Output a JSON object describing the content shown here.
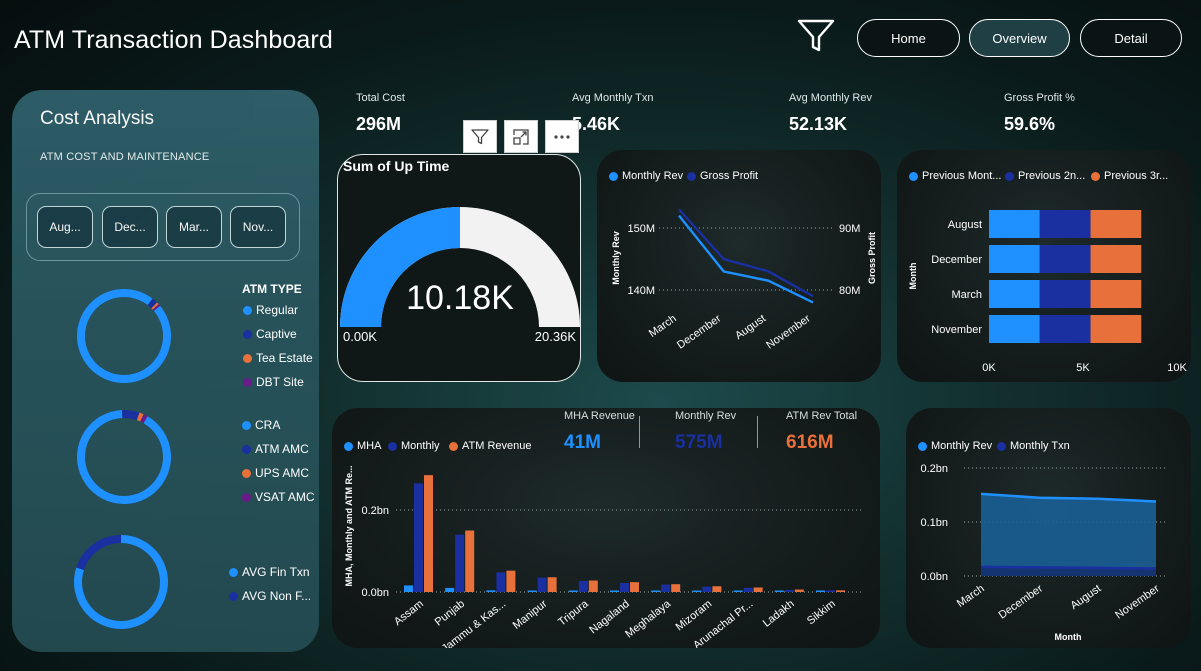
{
  "header": {
    "title": "ATM Transaction Dashboard",
    "nav": [
      "Home",
      "Overview",
      "Detail"
    ],
    "active_nav": "Overview"
  },
  "cost_panel": {
    "title": "Cost Analysis",
    "subtitle": "ATM COST AND MAINTENANCE",
    "month_slicer": [
      "Aug...",
      "Dec...",
      "Mar...",
      "Nov..."
    ],
    "legend1": {
      "title": "ATM TYPE",
      "items": [
        {
          "label": "Regular",
          "color": "#1e90ff"
        },
        {
          "label": "Captive",
          "color": "#1a2fa0"
        },
        {
          "label": "Tea Estate",
          "color": "#e8703a"
        },
        {
          "label": "DBT Site",
          "color": "#6a1b8a"
        }
      ]
    },
    "legend2": {
      "items": [
        {
          "label": "CRA",
          "color": "#1e90ff"
        },
        {
          "label": "ATM AMC",
          "color": "#1a2fa0"
        },
        {
          "label": "UPS AMC",
          "color": "#e8703a"
        },
        {
          "label": "VSAT AMC",
          "color": "#6a1b8a"
        }
      ]
    },
    "legend3": {
      "items": [
        {
          "label": "AVG Fin Txn",
          "color": "#1e90ff"
        },
        {
          "label": "AVG Non F...",
          "color": "#1a2fa0"
        }
      ]
    }
  },
  "kpis": [
    {
      "label": "Total Cost",
      "value": "296M"
    },
    {
      "label": "Avg Monthly Txn",
      "value": "5.46K"
    },
    {
      "label": "Avg Monthly Rev",
      "value": "52.13K"
    },
    {
      "label": "Gross Profit %",
      "value": "59.6%"
    }
  ],
  "gauge": {
    "title": "Sum of Up Time",
    "value_label": "10.18K",
    "min_label": "0.00K",
    "max_label": "20.36K",
    "value": 10.18,
    "max": 20.36
  },
  "revenue_boxes": {
    "mha": {
      "label": "MHA Revenue",
      "value": "41M"
    },
    "monthly": {
      "label": "Monthly Rev",
      "value": "575M"
    },
    "atm": {
      "label": "ATM Rev Total",
      "value": "616M"
    }
  },
  "colors": {
    "blue": "#1e90ff",
    "navy": "#1a2fa0",
    "orange": "#e8703a",
    "purple": "#6a1b8a"
  },
  "chart_data": [
    {
      "id": "donut_atm_type",
      "type": "pie",
      "categories": [
        "Regular",
        "Captive",
        "Tea Estate",
        "DBT Site"
      ],
      "values": [
        96.5,
        2.0,
        0.8,
        0.7
      ]
    },
    {
      "id": "donut_cost",
      "type": "pie",
      "categories": [
        "CRA",
        "ATM AMC",
        "UPS AMC",
        "VSAT AMC"
      ],
      "values": [
        91,
        6,
        1.5,
        1.5
      ]
    },
    {
      "id": "donut_txn",
      "type": "pie",
      "categories": [
        "AVG Fin Txn",
        "AVG Non F..."
      ],
      "values": [
        80,
        20
      ]
    },
    {
      "id": "monthly_rev_profit",
      "type": "line",
      "categories": [
        "March",
        "December",
        "August",
        "November"
      ],
      "series": [
        {
          "name": "Monthly Rev",
          "axis": "left",
          "values": [
            152,
            143,
            141.5,
            138
          ]
        },
        {
          "name": "Gross Profit",
          "axis": "right",
          "values": [
            93,
            85,
            83,
            79
          ]
        }
      ],
      "ylabel": "Monthly Rev",
      "y2label": "Gross Profit",
      "left_ticks": [
        "150M",
        "140M"
      ],
      "right_ticks": [
        "90M",
        "80M"
      ]
    },
    {
      "id": "previous_months",
      "type": "bar",
      "orientation": "horizontal",
      "stacked": true,
      "categories": [
        "August",
        "December",
        "March",
        "November"
      ],
      "series": [
        {
          "name": "Previous Mont...",
          "values": [
            2.7,
            2.7,
            2.7,
            2.7
          ]
        },
        {
          "name": "Previous 2n...",
          "values": [
            2.7,
            2.7,
            2.7,
            2.7
          ]
        },
        {
          "name": "Previous 3r...",
          "values": [
            2.7,
            2.7,
            2.7,
            2.7
          ]
        }
      ],
      "ylabel": "Month",
      "xticks": [
        "0K",
        "5K",
        "10K"
      ],
      "xlim": [
        0,
        10
      ]
    },
    {
      "id": "state_revenue",
      "type": "bar",
      "categories": [
        "Assam",
        "Punjab",
        "Jammu & Kas...",
        "Manipur",
        "Tripura",
        "Nagaland",
        "Meghalaya",
        "Mizoram",
        "Arunachal Pr...",
        "Ladakh",
        "Sikkim"
      ],
      "series": [
        {
          "name": "MHA",
          "values": [
            0.016,
            0.01,
            0.004,
            0.002,
            0.002,
            0.002,
            0.001,
            0.001,
            0.001,
            0.001,
            0.001
          ]
        },
        {
          "name": "Monthly",
          "values": [
            0.265,
            0.14,
            0.048,
            0.035,
            0.027,
            0.022,
            0.018,
            0.013,
            0.01,
            0.005,
            0.004
          ]
        },
        {
          "name": "ATM Revenue",
          "values": [
            0.285,
            0.15,
            0.052,
            0.036,
            0.028,
            0.024,
            0.019,
            0.014,
            0.011,
            0.006,
            0.004
          ]
        }
      ],
      "ylabel": "MHA, Monthly and ATM Re...",
      "yticks": [
        "0.2bn",
        "0.0bn"
      ]
    },
    {
      "id": "monthly_rev_txn_area",
      "type": "area",
      "categories": [
        "March",
        "December",
        "August",
        "November"
      ],
      "series": [
        {
          "name": "Monthly Rev",
          "values": [
            0.152,
            0.145,
            0.143,
            0.138
          ]
        },
        {
          "name": "Monthly Txn",
          "values": [
            0.017,
            0.016,
            0.015,
            0.014
          ]
        }
      ],
      "xlabel": "Month",
      "yticks": [
        "0.2bn",
        "0.1bn",
        "0.0bn"
      ],
      "ylim": [
        0,
        0.2
      ]
    }
  ]
}
